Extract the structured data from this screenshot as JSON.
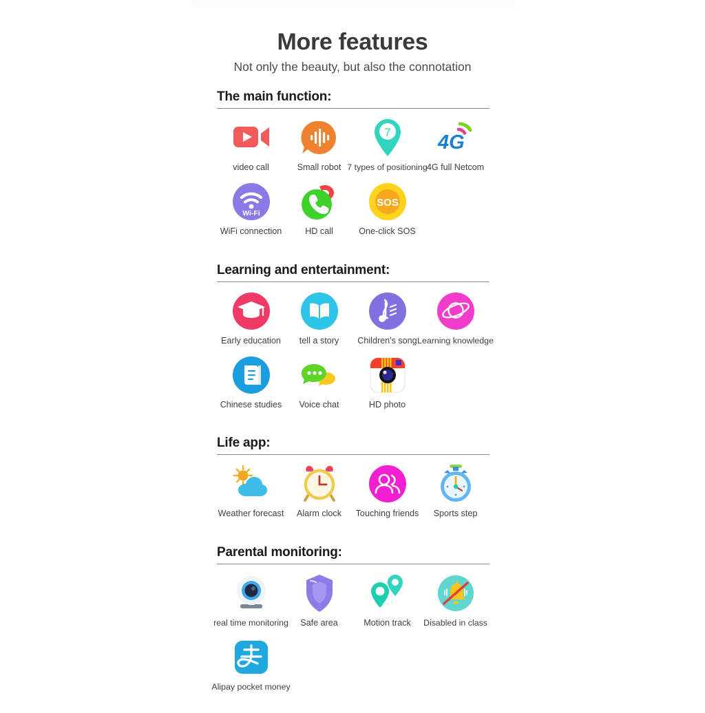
{
  "hero": {
    "title": "More features",
    "subtitle": "Not only the beauty, but also the connotation"
  },
  "colors": {
    "title": "#3a3a3a",
    "label": "#3f3f3f",
    "rule": "#8a8a8a",
    "video_red": "#f05a5a",
    "robot_orange": "#ef8230",
    "pin_teal": "#2fd6bd",
    "netcom_blue": "#1b7fd4",
    "wifi_purple": "#8a7ae8",
    "call_green": "#3fd22a",
    "sos_yellow": "#ffd21e",
    "edu_pink": "#ef3a66",
    "story_cyan": "#2ec4e8",
    "song_purple": "#7f72e0",
    "knowledge_magenta": "#f23ccb",
    "chinese_blue": "#1a9ee0",
    "voice_green": "#5ed428",
    "photo_red": "#f2402a",
    "weather_blue": "#3fbce8",
    "clock_yellow": "#f2c94c",
    "friends_magenta": "#f11fd1",
    "sports_blue": "#3f8fe0",
    "cam_blue": "#3fa9e8",
    "shield_purple": "#8c7be8",
    "track_teal": "#1ecfae",
    "disabled_teal": "#5fd6cf",
    "alipay_blue": "#1fa8e0"
  },
  "sections": [
    {
      "heading": "The main function:",
      "rows": [
        [
          {
            "label": "video call",
            "icon": "video-call-icon"
          },
          {
            "label": "Small robot",
            "icon": "small-robot-icon"
          },
          {
            "label": "7 types of positioning",
            "icon": "positioning-pin-icon",
            "badge": "7"
          },
          {
            "label": "4G full Netcom",
            "icon": "4g-netcom-icon",
            "badge": "4G"
          }
        ],
        [
          {
            "label": "WiFi connection",
            "icon": "wifi-icon",
            "badge": "Wi-Fi"
          },
          {
            "label": "HD call",
            "icon": "hd-call-icon"
          },
          {
            "label": "One-click SOS",
            "icon": "sos-icon",
            "badge": "SOS"
          }
        ]
      ]
    },
    {
      "heading": "Learning and entertainment:",
      "rows": [
        [
          {
            "label": "Early education",
            "icon": "graduation-cap-icon"
          },
          {
            "label": "tell a story",
            "icon": "open-book-icon"
          },
          {
            "label": "Children's song",
            "icon": "music-note-icon"
          },
          {
            "label": "Learning knowledge",
            "icon": "planet-icon"
          }
        ],
        [
          {
            "label": "Chinese studies",
            "icon": "chinese-studies-icon"
          },
          {
            "label": "Voice chat",
            "icon": "voice-chat-icon"
          },
          {
            "label": "HD photo",
            "icon": "hd-photo-camera-icon"
          }
        ]
      ]
    },
    {
      "heading": "Life app:",
      "rows": [
        [
          {
            "label": "Weather forecast",
            "icon": "weather-sun-cloud-icon"
          },
          {
            "label": "Alarm clock",
            "icon": "alarm-clock-icon"
          },
          {
            "label": "Touching friends",
            "icon": "touching-friends-icon"
          },
          {
            "label": "Sports step",
            "icon": "stopwatch-icon"
          }
        ]
      ]
    },
    {
      "heading": "Parental monitoring:",
      "rows": [
        [
          {
            "label": "real time monitoring",
            "icon": "webcam-icon"
          },
          {
            "label": "Safe area",
            "icon": "shield-icon"
          },
          {
            "label": "Motion track",
            "icon": "motion-track-icon"
          },
          {
            "label": "Disabled in class",
            "icon": "bell-disabled-icon"
          }
        ],
        [
          {
            "label": "Alipay pocket money",
            "icon": "alipay-icon"
          }
        ]
      ]
    }
  ]
}
